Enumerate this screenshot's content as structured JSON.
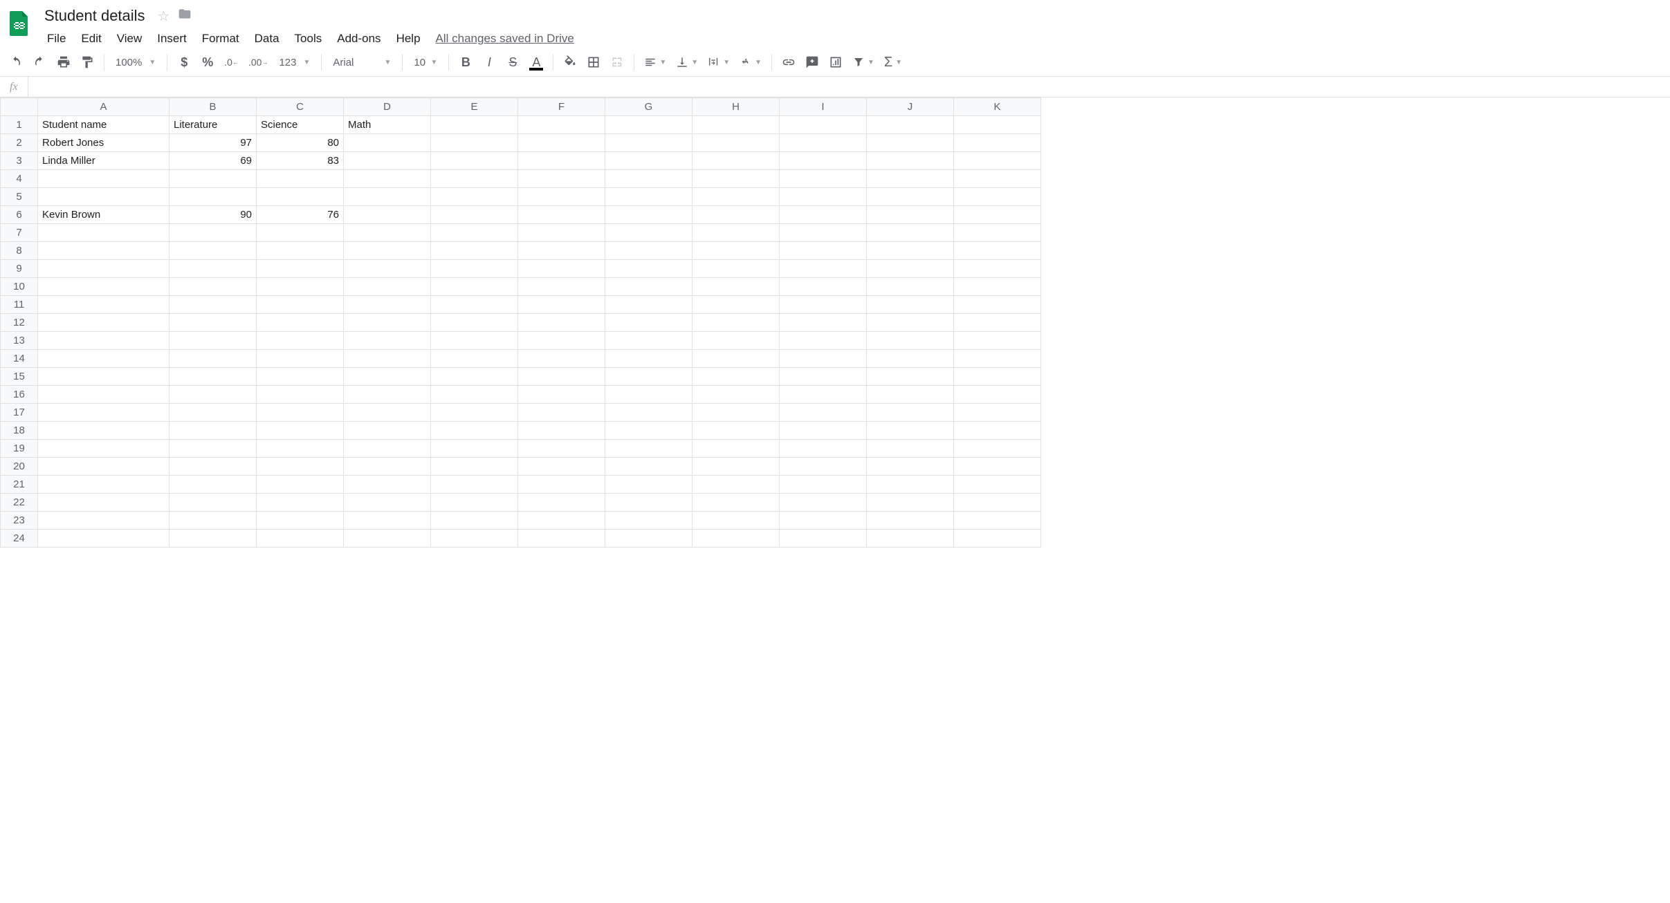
{
  "header": {
    "doc_title": "Student details",
    "menu": [
      "File",
      "Edit",
      "View",
      "Insert",
      "Format",
      "Data",
      "Tools",
      "Add-ons",
      "Help"
    ],
    "save_status": "All changes saved in Drive"
  },
  "toolbar": {
    "zoom": "100%",
    "font": "Arial",
    "font_size": "10",
    "format_123": "123"
  },
  "fx": {
    "label": "fx",
    "value": ""
  },
  "columns": [
    "A",
    "B",
    "C",
    "D",
    "E",
    "F",
    "G",
    "H",
    "I",
    "J",
    "K"
  ],
  "rows": [
    "1",
    "2",
    "3",
    "4",
    "5",
    "6",
    "7",
    "8",
    "9",
    "10",
    "11",
    "12",
    "13",
    "14",
    "15",
    "16",
    "17",
    "18",
    "19",
    "20",
    "21",
    "22",
    "23",
    "24"
  ],
  "cells": {
    "r1": {
      "A": "Student name",
      "B": "Literature",
      "C": "Science",
      "D": "Math"
    },
    "r2": {
      "A": "Robert Jones",
      "B": "97",
      "C": "80"
    },
    "r3": {
      "A": "Linda Miller",
      "B": "69",
      "C": "83"
    },
    "r6": {
      "A": "Kevin Brown",
      "B": "90",
      "C": "76"
    }
  }
}
